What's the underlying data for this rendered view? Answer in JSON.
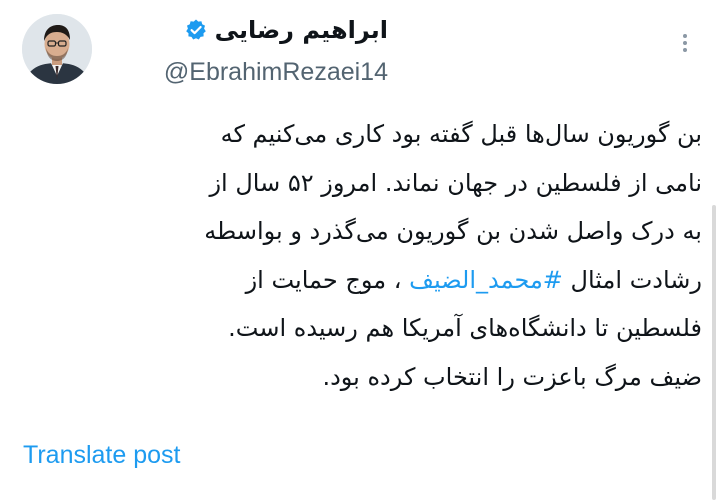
{
  "author": {
    "display_name": "ابراهیم رضایی",
    "handle": "@EbrahimRezaei14",
    "verified": true,
    "verified_color": "#1d9bf0"
  },
  "post": {
    "lines": [
      {
        "text": "بن گوریون سال‌ها قبل گفته بود کاری می‌کنیم که"
      },
      {
        "text": "نامی از فلسطین در جهان نماند. امروز ۵۲ سال از"
      },
      {
        "text": "به درک واصل شدن بن گوریون می‌گذرد و بواسطه"
      },
      {
        "before": "رشادت امثال ",
        "hashtag": "#محمد_الضیف",
        "after": " ، موج حمایت از"
      },
      {
        "text": "فلسطین تا دانشگاه‌های آمریکا هم رسیده است."
      },
      {
        "text": "ضیف مرگ باعزت را انتخاب کرده بود."
      }
    ]
  },
  "actions": {
    "translate_label": "Translate post",
    "more_icon": "more-dots-icon"
  },
  "colors": {
    "link": "#1d9bf0",
    "text": "#0f1419",
    "secondary": "#536471"
  }
}
